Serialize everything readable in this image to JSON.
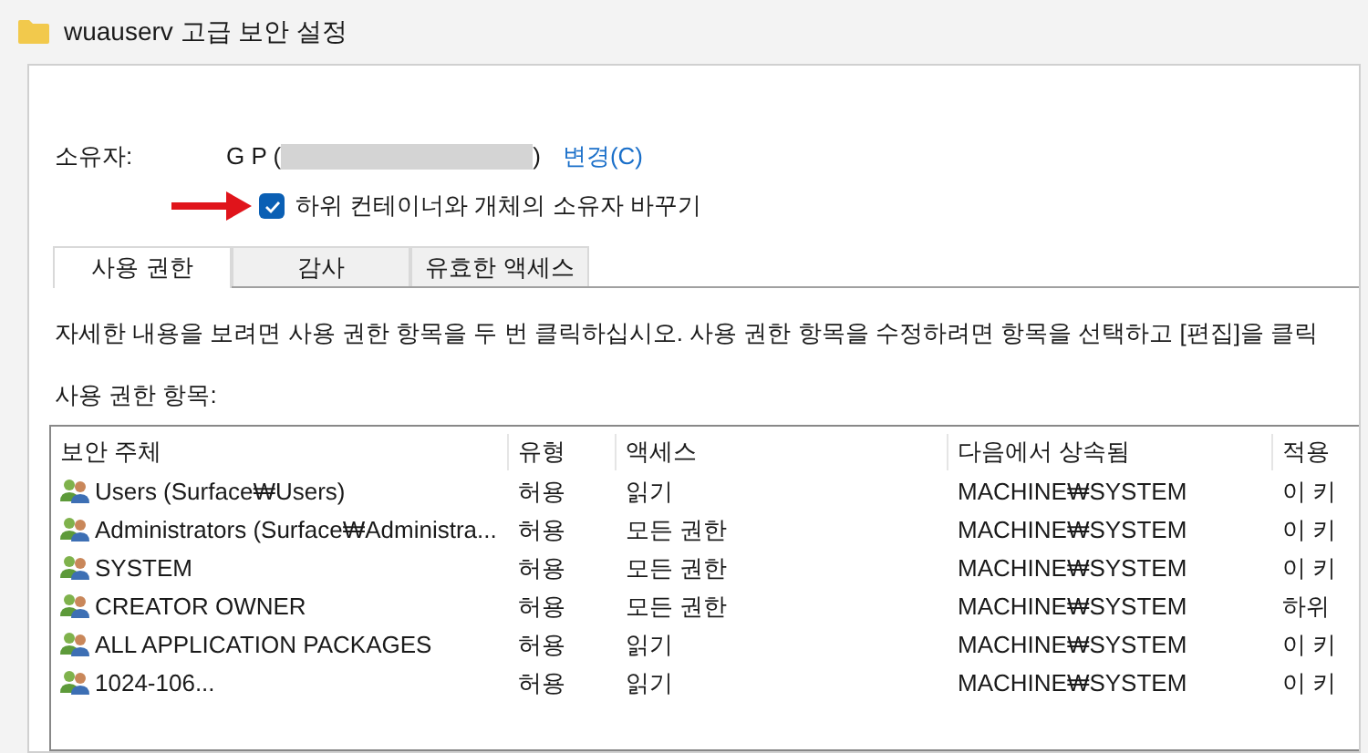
{
  "window": {
    "title": "wuauserv 고급 보안 설정"
  },
  "owner": {
    "label": "소유자:",
    "name_start": "G P (",
    "name_end": ")",
    "change_link": "변경(C)"
  },
  "replace_owner": {
    "label": "하위 컨테이너와 개체의 소유자 바꾸기",
    "checked": true
  },
  "tabs": [
    {
      "label": "사용 권한",
      "selected": true
    },
    {
      "label": "감사",
      "selected": false
    },
    {
      "label": "유효한 액세스",
      "selected": false
    }
  ],
  "description": "자세한 내용을 보려면 사용 권한 항목을 두 번 클릭하십시오. 사용 권한 항목을 수정하려면 항목을 선택하고 [편집]을 클릭",
  "entries_label": "사용 권한 항목:",
  "table": {
    "columns": [
      "보안 주체",
      "유형",
      "액세스",
      "다음에서 상속됨",
      "적용"
    ],
    "rows": [
      {
        "principal": "Users (Surface₩Users)",
        "type": "허용",
        "access": "읽기",
        "inherited_from": "MACHINE₩SYSTEM",
        "applies_to": "이 키"
      },
      {
        "principal": "Administrators (Surface₩Administra...",
        "type": "허용",
        "access": "모든 권한",
        "inherited_from": "MACHINE₩SYSTEM",
        "applies_to": "이 키"
      },
      {
        "principal": "SYSTEM",
        "type": "허용",
        "access": "모든 권한",
        "inherited_from": "MACHINE₩SYSTEM",
        "applies_to": "이 키"
      },
      {
        "principal": "CREATOR OWNER",
        "type": "허용",
        "access": "모든 권한",
        "inherited_from": "MACHINE₩SYSTEM",
        "applies_to": "하위"
      },
      {
        "principal": "ALL APPLICATION PACKAGES",
        "type": "허용",
        "access": "읽기",
        "inherited_from": "MACHINE₩SYSTEM",
        "applies_to": "이 키"
      },
      {
        "principal": "1024-106...",
        "type": "허용",
        "access": "읽기",
        "inherited_from": "MACHINE₩SYSTEM",
        "applies_to": "이 키"
      }
    ]
  }
}
